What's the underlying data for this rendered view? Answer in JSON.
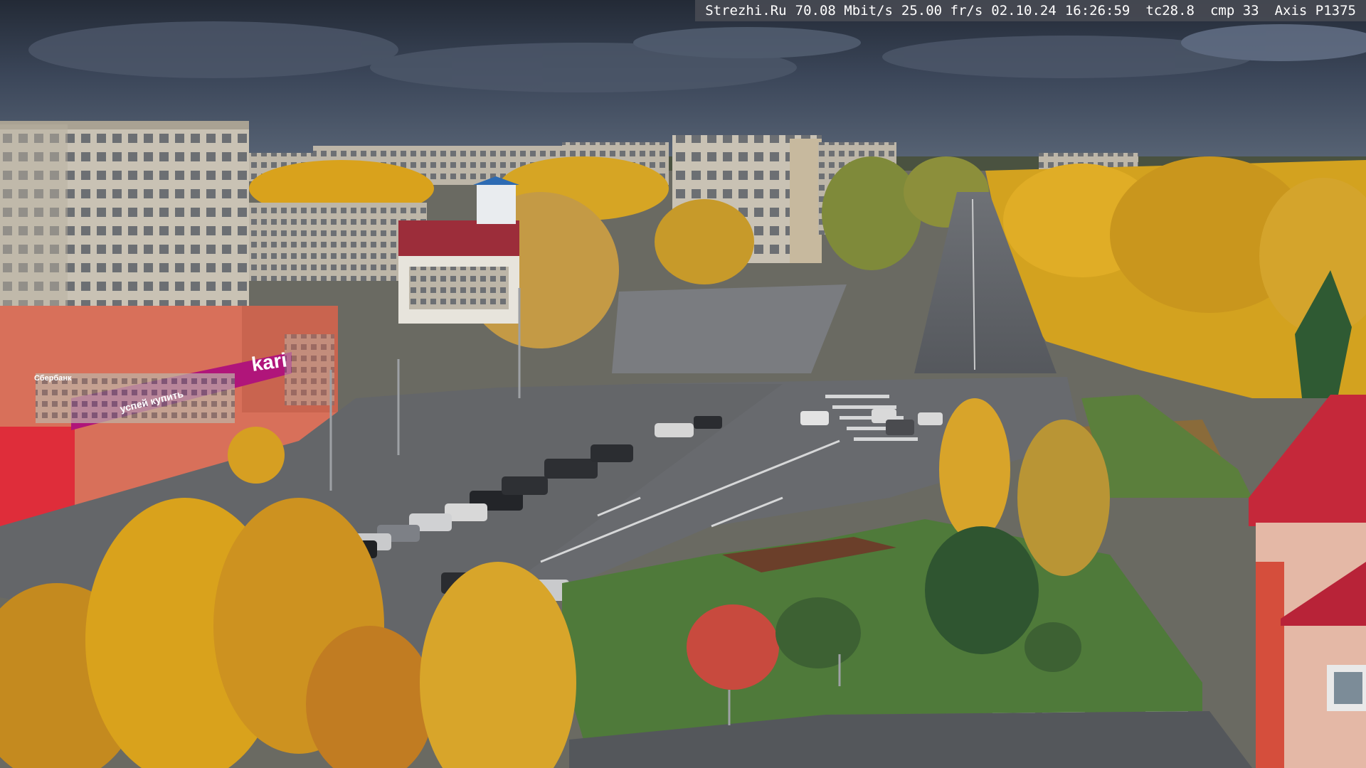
{
  "overlay": {
    "site": "Strezhi.Ru",
    "bitrate": "70.08 Mbit/s",
    "framerate": "25.00 fr/s",
    "date": "02.10.24",
    "time": "16:26:59",
    "tc": "tc28.8",
    "cmp": "cmp 33",
    "camera": "Axis P1375"
  },
  "signs": {
    "store_brand": "kari",
    "store_slogan": "успей купить",
    "bank_sign": "Сбербанк"
  },
  "colors": {
    "sky": "#3a4456",
    "asphalt": "#5b5e63",
    "foliage": "#d9a21c",
    "store_magenta": "#b0157a",
    "brick": "#d8705a"
  }
}
